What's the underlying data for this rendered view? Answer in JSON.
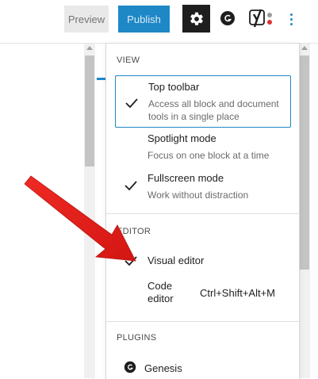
{
  "toolbar": {
    "preview_label": "Preview",
    "publish_label": "Publish",
    "settings_icon": "gear-icon",
    "genesis_icon": "genesis-icon",
    "yoast_icon": "yoast-icon",
    "more_icon": "vertical-ellipsis-icon",
    "accent_color": "#1e88c7"
  },
  "menu": {
    "view_section": {
      "label": "VIEW",
      "items": [
        {
          "title": "Top toolbar",
          "description": "Access all block and document tools in a single place",
          "checked": true
        },
        {
          "title": "Spotlight mode",
          "description": "Focus on one block at a time",
          "checked": false
        },
        {
          "title": "Fullscreen mode",
          "description": "Work without distraction",
          "checked": true
        }
      ]
    },
    "editor_section": {
      "label": "EDITOR",
      "items": [
        {
          "title": "Visual editor",
          "checked": true
        },
        {
          "title": "Code editor",
          "shortcut": "Ctrl+Shift+Alt+M",
          "checked": false
        }
      ]
    },
    "plugins_section": {
      "label": "PLUGINS",
      "items": [
        {
          "title": "Genesis",
          "icon": "genesis-icon"
        }
      ]
    }
  },
  "annotation": {
    "type": "red-arrow",
    "color": "#e8201d",
    "points_to": "Visual editor"
  }
}
